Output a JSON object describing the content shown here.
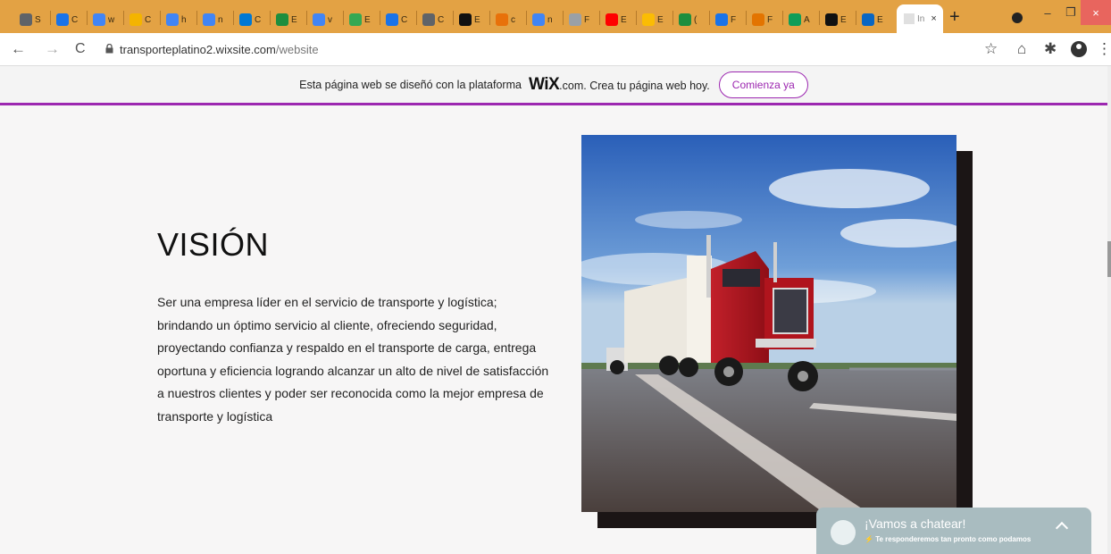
{
  "browser": {
    "tabs": [
      {
        "title": "S",
        "color": "#5f6368"
      },
      {
        "title": "C",
        "color": "#1a73e8"
      },
      {
        "title": "w",
        "color": "#4285f4"
      },
      {
        "title": "C",
        "color": "#f4b400"
      },
      {
        "title": "h",
        "color": "#4285f4"
      },
      {
        "title": "n",
        "color": "#4285f4"
      },
      {
        "title": "C",
        "color": "#0078d4"
      },
      {
        "title": "E",
        "color": "#1e8e3e"
      },
      {
        "title": "v",
        "color": "#4285f4"
      },
      {
        "title": "E",
        "color": "#34a853"
      },
      {
        "title": "C",
        "color": "#1a73e8"
      },
      {
        "title": "C",
        "color": "#5f6368"
      },
      {
        "title": "E",
        "color": "#111111"
      },
      {
        "title": "c",
        "color": "#e8710a"
      },
      {
        "title": "n",
        "color": "#4285f4"
      },
      {
        "title": "F",
        "color": "#9aa0a6"
      },
      {
        "title": "E",
        "color": "#ff0000"
      },
      {
        "title": "E",
        "color": "#fbbc04"
      },
      {
        "title": "(",
        "color": "#1e8e3e"
      },
      {
        "title": "F",
        "color": "#1a73e8"
      },
      {
        "title": "F",
        "color": "#e37400"
      },
      {
        "title": "A",
        "color": "#0f9d58"
      },
      {
        "title": "E",
        "color": "#111111"
      },
      {
        "title": "E",
        "color": "#0a66c2"
      }
    ],
    "active_tab": {
      "title": "In",
      "close": "×"
    },
    "new_tab": "+",
    "window_controls": {
      "minimize": "–",
      "restore": "❐",
      "close": "×"
    },
    "nav": {
      "back": "←",
      "forward": "→",
      "reload": "C"
    },
    "url_domain": "transporteplatino2.wixsite.com",
    "url_path": "/website",
    "toolbar_icons": {
      "star": "☆",
      "home": "⌂",
      "extensions": "✱",
      "menu": "⋮"
    }
  },
  "banner": {
    "text_before": "Esta página web se diseñó con la plataforma",
    "brand": "WiX",
    "text_after": ".com. Crea tu página web hoy.",
    "cta": "Comienza ya",
    "accent": "#9c27b0"
  },
  "content": {
    "title": "VISIÓN",
    "paragraph": "Ser una empresa líder en el servicio de transporte y logística; brindando un óptimo servicio al cliente, ofreciendo seguridad, proyectando confianza y respaldo en el transporte de carga, entrega oportuna y eficiencia logrando alcanzar un alto de nivel de satisfacción a nuestros clientes y poder ser reconocida como la mejor empresa de transporte y logística"
  },
  "chat": {
    "title": "¡Vamos a chatear!",
    "subtitle": "Te responderemos tan pronto como podamos"
  }
}
